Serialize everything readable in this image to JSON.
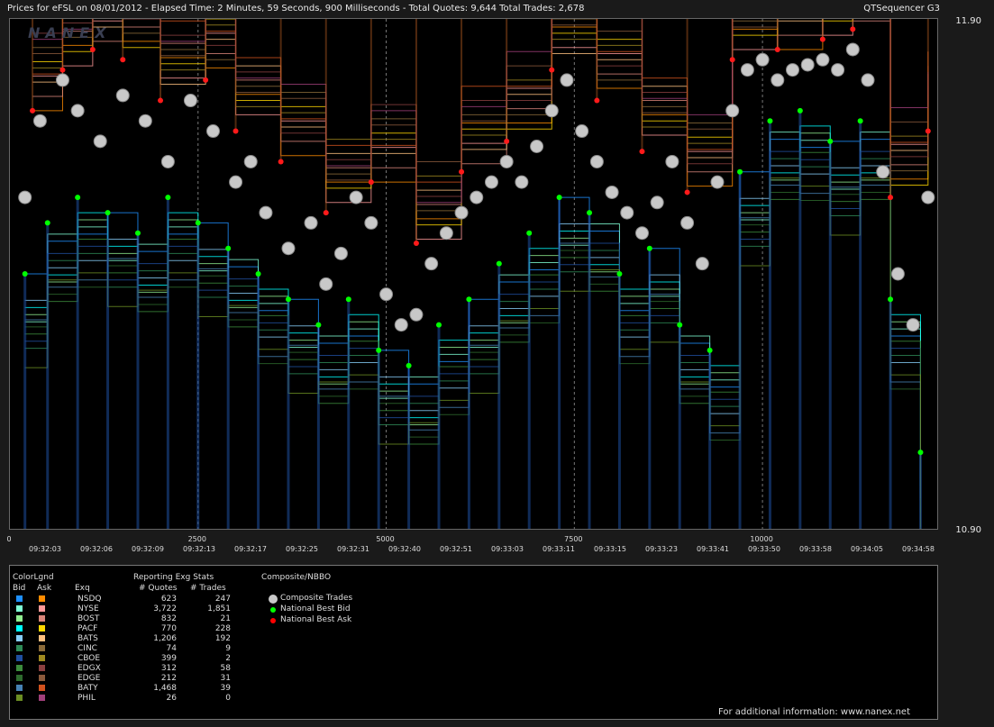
{
  "header": {
    "title": "Prices for  eFSL  on  08/01/2012  -  Elapsed Time: 2 Minutes, 59 Seconds, 900 Milliseconds  -  Total Quotes: 9,644  Total Trades: 2,678",
    "app_name": "QTSequencer G3",
    "watermark": "NANEX"
  },
  "chart_data": {
    "type": "scatter",
    "ylim": [
      10.9,
      11.9
    ],
    "y_tick_labels": [
      "11.90",
      "10.90"
    ],
    "x_count_ticks": [
      {
        "value": 0,
        "label": "0"
      },
      {
        "value": 2500,
        "label": "2500"
      },
      {
        "value": 5000,
        "label": "5000"
      },
      {
        "value": 7500,
        "label": "7500"
      },
      {
        "value": 10000,
        "label": "10000"
      }
    ],
    "x_time_labels": [
      "09:32:03",
      "09:32:06",
      "09:32:09",
      "09:32:13",
      "09:32:17",
      "09:32:25",
      "09:32:31",
      "09:32:40",
      "09:32:51",
      "09:33:03",
      "09:33:11",
      "09:33:15",
      "09:33:23",
      "09:33:41",
      "09:33:50",
      "09:33:58",
      "09:34:05",
      "09:34:58"
    ],
    "x_max": 12322,
    "composite_trades": [
      [
        200,
        11.55
      ],
      [
        400,
        11.7
      ],
      [
        700,
        11.78
      ],
      [
        900,
        11.72
      ],
      [
        1200,
        11.66
      ],
      [
        1500,
        11.75
      ],
      [
        1800,
        11.7
      ],
      [
        2100,
        11.62
      ],
      [
        2400,
        11.74
      ],
      [
        2700,
        11.68
      ],
      [
        3000,
        11.58
      ],
      [
        3200,
        11.62
      ],
      [
        3400,
        11.52
      ],
      [
        3700,
        11.45
      ],
      [
        4000,
        11.5
      ],
      [
        4200,
        11.38
      ],
      [
        4400,
        11.44
      ],
      [
        4600,
        11.55
      ],
      [
        4800,
        11.5
      ],
      [
        5000,
        11.36
      ],
      [
        5200,
        11.3
      ],
      [
        5400,
        11.32
      ],
      [
        5600,
        11.42
      ],
      [
        5800,
        11.48
      ],
      [
        6000,
        11.52
      ],
      [
        6200,
        11.55
      ],
      [
        6400,
        11.58
      ],
      [
        6600,
        11.62
      ],
      [
        6800,
        11.58
      ],
      [
        7000,
        11.65
      ],
      [
        7200,
        11.72
      ],
      [
        7400,
        11.78
      ],
      [
        7600,
        11.68
      ],
      [
        7800,
        11.62
      ],
      [
        8000,
        11.56
      ],
      [
        8200,
        11.52
      ],
      [
        8400,
        11.48
      ],
      [
        8600,
        11.54
      ],
      [
        8800,
        11.62
      ],
      [
        9000,
        11.5
      ],
      [
        9200,
        11.42
      ],
      [
        9400,
        11.58
      ],
      [
        9600,
        11.72
      ],
      [
        9800,
        11.8
      ],
      [
        10000,
        11.82
      ],
      [
        10200,
        11.78
      ],
      [
        10400,
        11.8
      ],
      [
        10600,
        11.81
      ],
      [
        10800,
        11.82
      ],
      [
        11000,
        11.8
      ],
      [
        11200,
        11.84
      ],
      [
        11400,
        11.78
      ],
      [
        11600,
        11.6
      ],
      [
        11800,
        11.4
      ],
      [
        12000,
        11.3
      ],
      [
        12200,
        11.55
      ]
    ],
    "national_best_bid": [
      [
        200,
        11.4
      ],
      [
        500,
        11.5
      ],
      [
        900,
        11.55
      ],
      [
        1300,
        11.52
      ],
      [
        1700,
        11.48
      ],
      [
        2100,
        11.55
      ],
      [
        2500,
        11.5
      ],
      [
        2900,
        11.45
      ],
      [
        3300,
        11.4
      ],
      [
        3700,
        11.35
      ],
      [
        4100,
        11.3
      ],
      [
        4500,
        11.35
      ],
      [
        4900,
        11.25
      ],
      [
        5300,
        11.22
      ],
      [
        5700,
        11.3
      ],
      [
        6100,
        11.35
      ],
      [
        6500,
        11.42
      ],
      [
        6900,
        11.48
      ],
      [
        7300,
        11.55
      ],
      [
        7700,
        11.52
      ],
      [
        8100,
        11.4
      ],
      [
        8500,
        11.45
      ],
      [
        8900,
        11.3
      ],
      [
        9300,
        11.25
      ],
      [
        9700,
        11.6
      ],
      [
        10100,
        11.7
      ],
      [
        10500,
        11.72
      ],
      [
        10900,
        11.66
      ],
      [
        11300,
        11.7
      ],
      [
        11700,
        11.35
      ],
      [
        12100,
        11.05
      ]
    ],
    "national_best_ask": [
      [
        300,
        11.72
      ],
      [
        700,
        11.8
      ],
      [
        1100,
        11.84
      ],
      [
        1500,
        11.82
      ],
      [
        2000,
        11.74
      ],
      [
        2600,
        11.78
      ],
      [
        3000,
        11.68
      ],
      [
        3600,
        11.62
      ],
      [
        4200,
        11.52
      ],
      [
        4800,
        11.58
      ],
      [
        5400,
        11.46
      ],
      [
        6000,
        11.6
      ],
      [
        6600,
        11.66
      ],
      [
        7200,
        11.8
      ],
      [
        7800,
        11.74
      ],
      [
        8400,
        11.64
      ],
      [
        9000,
        11.56
      ],
      [
        9600,
        11.82
      ],
      [
        10200,
        11.84
      ],
      [
        10800,
        11.86
      ],
      [
        11200,
        11.88
      ],
      [
        11700,
        11.55
      ],
      [
        12200,
        11.68
      ]
    ]
  },
  "legend": {
    "color_legend_title": "ColorLgnd",
    "bid_header": "Bid",
    "ask_header": "Ask",
    "exg_header": "Exq",
    "stats_title": "Reporting Exg Stats",
    "quotes_header": "# Quotes",
    "trades_header": "# Trades",
    "composite_title": "Composite/NBBO",
    "exchanges": [
      {
        "name": "NSDQ",
        "quotes": "623",
        "trades": "247",
        "bid_color": "#1e90ff",
        "ask_color": "#ff8c00"
      },
      {
        "name": "NYSE",
        "quotes": "3,722",
        "trades": "1,851",
        "bid_color": "#7fffd4",
        "ask_color": "#ff9999"
      },
      {
        "name": "BOST",
        "quotes": "832",
        "trades": "21",
        "bid_color": "#90ee90",
        "ask_color": "#d9857a"
      },
      {
        "name": "PACF",
        "quotes": "770",
        "trades": "228",
        "bid_color": "#00ffff",
        "ask_color": "#ffd700"
      },
      {
        "name": "BATS",
        "quotes": "1,206",
        "trades": "192",
        "bid_color": "#87cefa",
        "ask_color": "#ffc080"
      },
      {
        "name": "CINC",
        "quotes": "74",
        "trades": "9",
        "bid_color": "#2e8b57",
        "ask_color": "#8b6b3a"
      },
      {
        "name": "CBOE",
        "quotes": "399",
        "trades": "2",
        "bid_color": "#1f4fa0",
        "ask_color": "#a08a20"
      },
      {
        "name": "EDGX",
        "quotes": "312",
        "trades": "58",
        "bid_color": "#3c8c3c",
        "ask_color": "#8b4040"
      },
      {
        "name": "EDGE",
        "quotes": "212",
        "trades": "31",
        "bid_color": "#2e6b2e",
        "ask_color": "#8b5a3c"
      },
      {
        "name": "BATY",
        "quotes": "1,468",
        "trades": "39",
        "bid_color": "#4682b4",
        "ask_color": "#d2521e"
      },
      {
        "name": "PHIL",
        "quotes": "26",
        "trades": "0",
        "bid_color": "#6b8e23",
        "ask_color": "#a0407a"
      }
    ],
    "composite_items": [
      {
        "label": "Composite Trades",
        "color": "#c8c8c8"
      },
      {
        "label": "National Best Bid",
        "color": "#00ff00"
      },
      {
        "label": "National Best Ask",
        "color": "#ff0000"
      }
    ],
    "footer": "For additional information: www.nanex.net"
  }
}
